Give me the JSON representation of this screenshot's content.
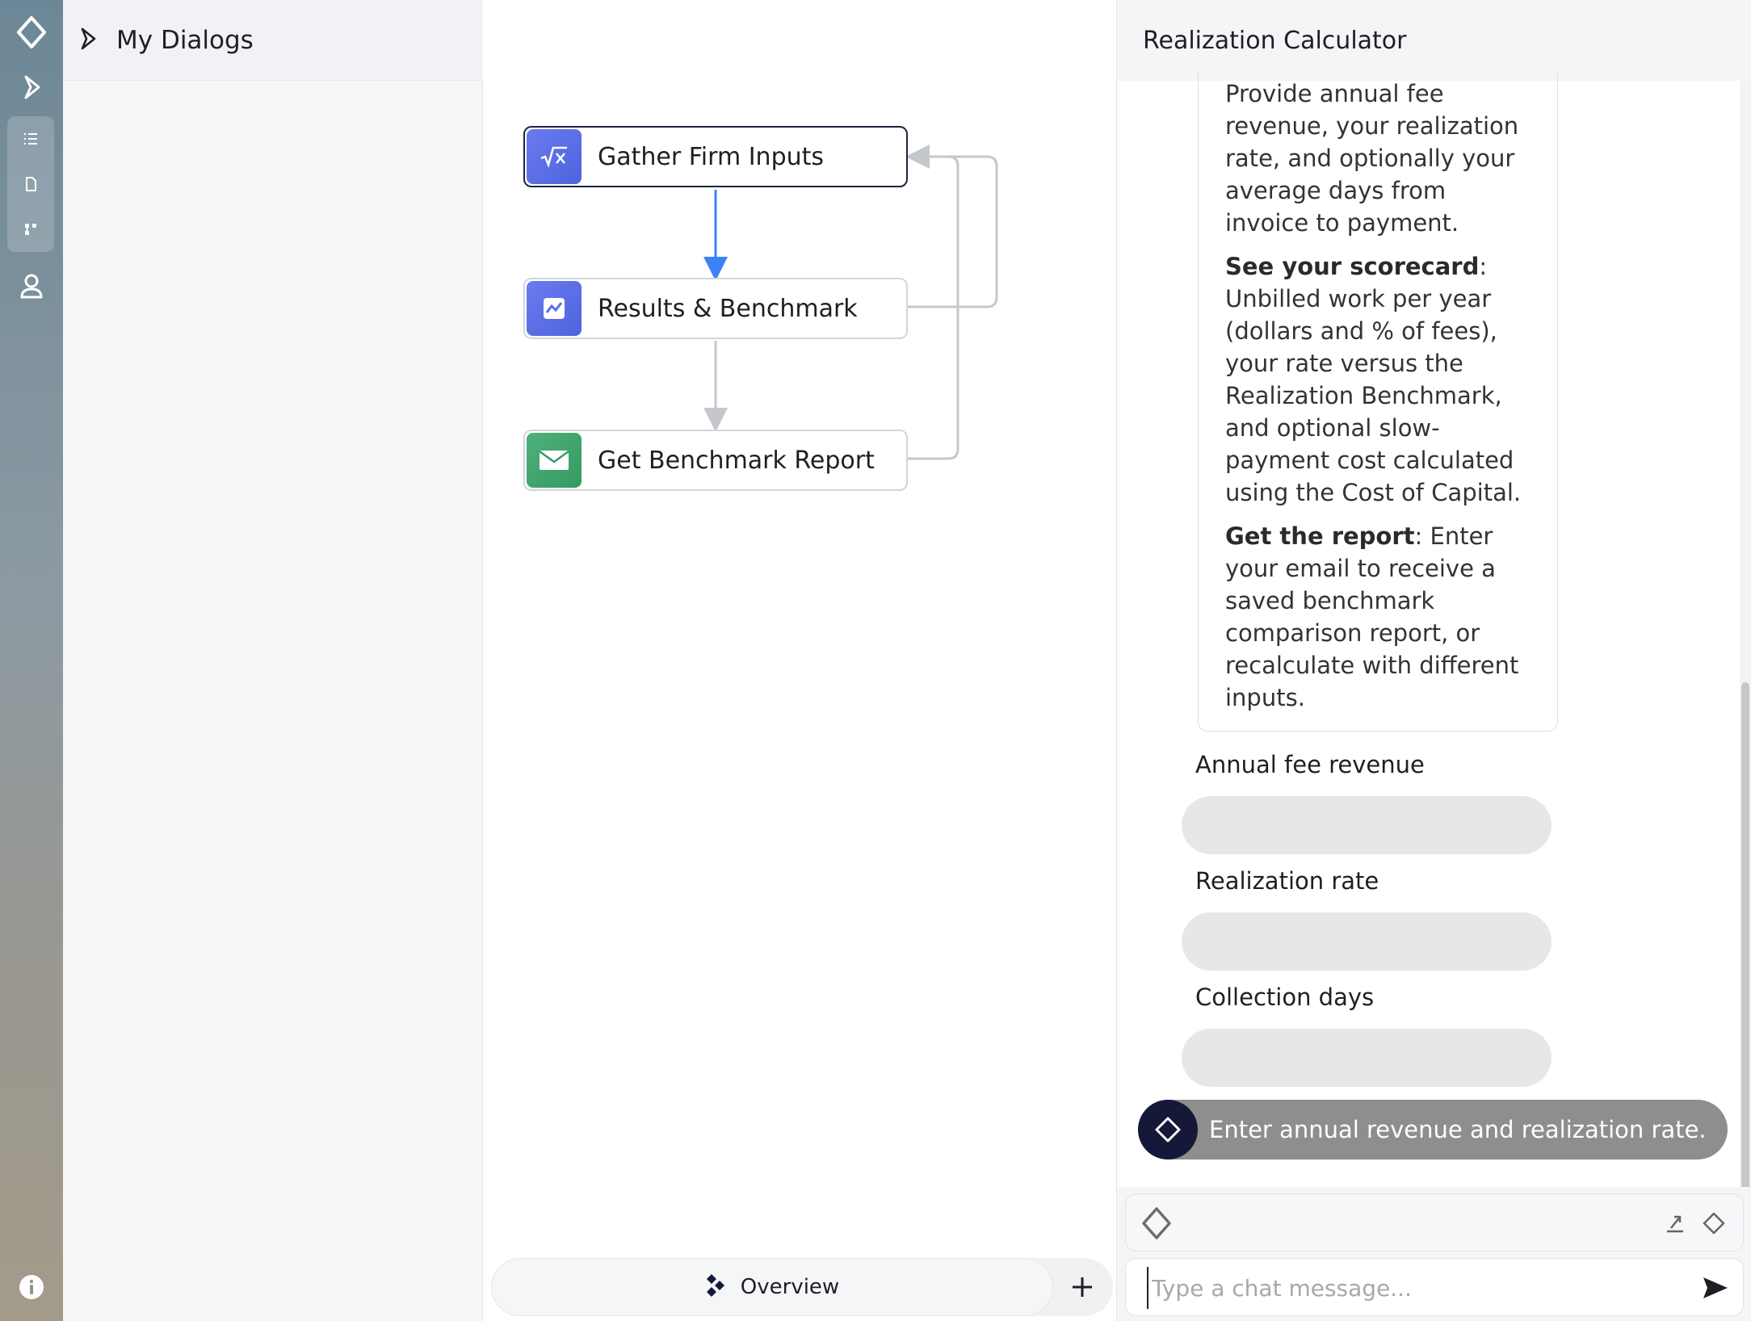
{
  "sidebar": {
    "dialogs_title": "My Dialogs"
  },
  "flow": {
    "nodes": [
      {
        "label": "Gather Firm Inputs",
        "icon": "sqrt-x-icon",
        "color": "#5a6ee8"
      },
      {
        "label": "Results & Benchmark",
        "icon": "line-chart-icon",
        "color": "#5a6ee8"
      },
      {
        "label": "Get Benchmark Report",
        "icon": "envelope-icon",
        "color": "#3fa06a"
      }
    ],
    "active_node": "Gather Firm Inputs"
  },
  "canvas_footer": {
    "overview_label": "Overview"
  },
  "panel": {
    "title": "Realization Calculator",
    "intro_tail": "Provide annual fee revenue, your realization rate, and optionally your average days from invoice to payment.",
    "scorecard_bold": "See your scorecard",
    "scorecard_text": ": Unbilled work per year (dollars and % of fees), your rate versus the Realization Benchmark, and optional slow-payment cost calculated using the Cost of Capital.",
    "report_bold": "Get the report",
    "report_text": ": Enter your email to receive a saved benchmark comparison report, or recalculate with different inputs.",
    "fields": [
      {
        "label": "Annual fee revenue",
        "value": ""
      },
      {
        "label": "Realization rate",
        "value": ""
      },
      {
        "label": "Collection days",
        "value": ""
      }
    ],
    "hint": "Enter annual revenue and realization rate.",
    "composer_placeholder": "Type a chat message..."
  },
  "colors": {
    "accent_dark": "#16183a",
    "active_edge": "#3b82f6",
    "edge": "#c4c7cc"
  }
}
